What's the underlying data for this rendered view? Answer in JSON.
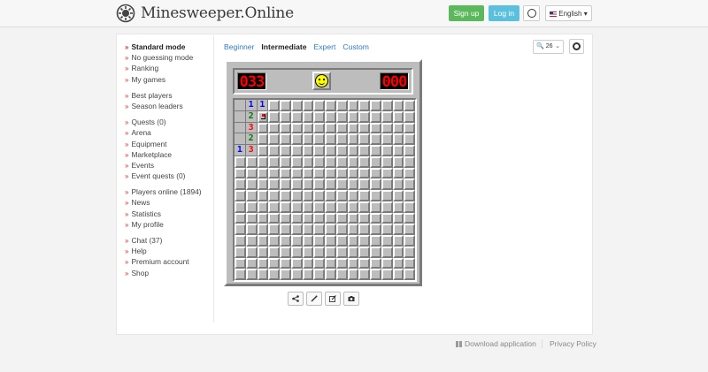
{
  "header": {
    "brand": "Minesweeper.Online",
    "signup_label": "Sign up",
    "login_label": "Log in",
    "language": "English ▾"
  },
  "sidebar": {
    "groups": [
      [
        {
          "label": "Standard mode",
          "active": true
        },
        {
          "label": "No guessing mode"
        },
        {
          "label": "Ranking"
        },
        {
          "label": "My games"
        }
      ],
      [
        {
          "label": "Best players"
        },
        {
          "label": "Season leaders"
        }
      ],
      [
        {
          "label": "Quests (0)"
        },
        {
          "label": "Arena"
        },
        {
          "label": "Equipment"
        },
        {
          "label": "Marketplace"
        },
        {
          "label": "Events"
        },
        {
          "label": "Event quests (0)"
        }
      ],
      [
        {
          "label": "Players online (1894)"
        },
        {
          "label": "News"
        },
        {
          "label": "Statistics"
        },
        {
          "label": "My profile"
        }
      ],
      [
        {
          "label": "Chat (37)"
        },
        {
          "label": "Help"
        },
        {
          "label": "Premium account"
        },
        {
          "label": "Shop"
        }
      ]
    ]
  },
  "tabs": [
    {
      "label": "Beginner"
    },
    {
      "label": "Intermediate",
      "active": true
    },
    {
      "label": "Expert"
    },
    {
      "label": "Custom"
    }
  ],
  "zoom": {
    "value": "26"
  },
  "game": {
    "mines_left": "033",
    "timer": "000",
    "rows": 16,
    "cols": 16,
    "open_cells": [
      {
        "r": 0,
        "c": 0,
        "v": ""
      },
      {
        "r": 0,
        "c": 1,
        "v": "1"
      },
      {
        "r": 0,
        "c": 2,
        "v": "1"
      },
      {
        "r": 1,
        "c": 0,
        "v": ""
      },
      {
        "r": 1,
        "c": 1,
        "v": "2"
      },
      {
        "r": 2,
        "c": 0,
        "v": ""
      },
      {
        "r": 2,
        "c": 1,
        "v": "3"
      },
      {
        "r": 3,
        "c": 0,
        "v": ""
      },
      {
        "r": 3,
        "c": 1,
        "v": "2"
      },
      {
        "r": 4,
        "c": 0,
        "v": "1"
      },
      {
        "r": 4,
        "c": 1,
        "v": "3"
      }
    ],
    "flags": [
      {
        "r": 1,
        "c": 2
      }
    ]
  },
  "toolbar": {
    "icons": [
      "share-icon",
      "wand-icon",
      "edit-icon",
      "camera-icon"
    ]
  },
  "footer": {
    "download_label": "Download application",
    "privacy_label": "Privacy Policy"
  }
}
